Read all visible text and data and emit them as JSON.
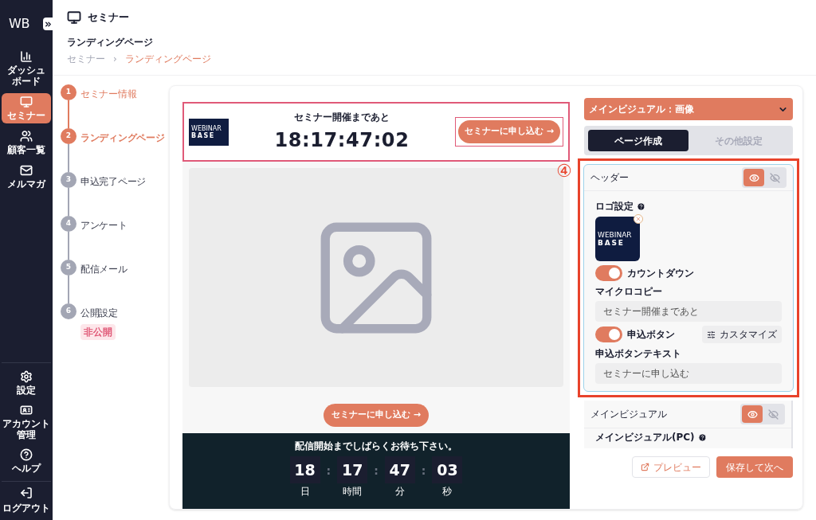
{
  "sidebar": {
    "logo": "WB",
    "nav_items": [
      {
        "kind": "chart",
        "lines": [
          "ダッシュ",
          "ボード"
        ],
        "selected": false
      },
      {
        "kind": "seminar",
        "lines": [
          "セミナー"
        ],
        "selected": true
      },
      {
        "kind": "people",
        "lines": [
          "顧客一覧"
        ],
        "selected": false
      },
      {
        "kind": "mail",
        "lines": [
          "メルマガ"
        ],
        "selected": false
      }
    ],
    "bottom_items": [
      {
        "kind": "gear",
        "lines": [
          "設定"
        ]
      },
      {
        "kind": "card",
        "lines": [
          "アカウント",
          "管理"
        ]
      },
      {
        "kind": "help",
        "lines": [
          "ヘルプ"
        ]
      }
    ],
    "logout": {
      "lines": [
        "ログアウト"
      ]
    }
  },
  "page_header": {
    "title": "セミナー",
    "subtitle": "ランディングページ",
    "breadcrumb": [
      "セミナー",
      "ランディングページ"
    ],
    "breadcrumb_separator": "›"
  },
  "steps": [
    {
      "number": "1",
      "label": "セミナー情報",
      "done": true,
      "selected": false
    },
    {
      "number": "2",
      "label": "ランディングページ",
      "done": false,
      "selected": true
    },
    {
      "number": "3",
      "label": "申込完了ページ",
      "done": false,
      "selected": false
    },
    {
      "number": "4",
      "label": "アンケート",
      "done": false,
      "selected": false
    },
    {
      "number": "5",
      "label": "配信メール",
      "done": false,
      "selected": false
    },
    {
      "number": "6",
      "label": "公開設定",
      "done": false,
      "selected": false,
      "badge": "非公開"
    }
  ],
  "preview": {
    "header": {
      "outlined": true,
      "logo": [
        "WEBINAR",
        "BASE"
      ],
      "caption": "セミナー開催まであと",
      "countdown": "18:17:47:02",
      "button": {
        "label": "セミナーに申し込む →",
        "outlined": true
      }
    },
    "cta": "セミナーに申し込む →",
    "footer": {
      "message": "配信開始までしばらくお待ち下さい。",
      "separator": ":",
      "units": [
        {
          "value": "18",
          "unit": "日"
        },
        {
          "value": "17",
          "unit": "時間"
        },
        {
          "value": "47",
          "unit": "分"
        },
        {
          "value": "03",
          "unit": "秒"
        }
      ]
    }
  },
  "editor": {
    "dropdown": "メインビジュアル：画像",
    "tabs": [
      {
        "label": "ページ作成",
        "selected": true
      },
      {
        "label": "その他設定",
        "selected": false
      }
    ],
    "marker": "④",
    "header_section": {
      "title": "ヘッダー",
      "visible": true,
      "logo_label": "ロゴ設定",
      "logo": [
        "WEBINAR",
        "BASE"
      ],
      "countdown_toggle": {
        "label": "カウントダウン",
        "on": true
      },
      "micro_copy": {
        "label": "マイクロコピー",
        "value": "セミナー開催まであと"
      },
      "apply_toggle": {
        "label": "申込ボタン",
        "on": true
      },
      "customize": "カスタマイズ",
      "button_text": {
        "label": "申込ボタンテキスト",
        "value": "セミナーに申し込む"
      }
    },
    "main_visual_section": {
      "title": "メインビジュアル",
      "visible": true,
      "sub_label": "メインビジュアル(PC)"
    },
    "preview_button": "プレビュー",
    "save_button": "保存して次へ"
  }
}
